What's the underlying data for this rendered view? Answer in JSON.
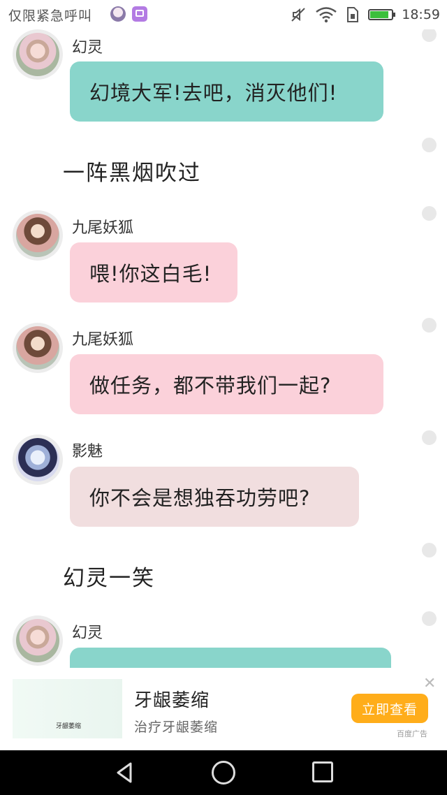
{
  "status_bar": {
    "left_text": "仅限紧急呼叫",
    "time": "18:59"
  },
  "chat": {
    "messages": [
      {
        "type": "character",
        "name": "幻灵",
        "text": "幻境大军!去吧，消灭他们!",
        "bubble_color": "#89d5cb"
      },
      {
        "type": "narration",
        "text": "一阵黑烟吹过"
      },
      {
        "type": "character",
        "name": "九尾妖狐",
        "text": "喂!你这白毛!",
        "bubble_color": "#fbd1da"
      },
      {
        "type": "character",
        "name": "九尾妖狐",
        "text": "做任务，都不带我们一起?",
        "bubble_color": "#fbd1da"
      },
      {
        "type": "character",
        "name": "影魅",
        "text": "你不会是想独吞功劳吧?",
        "bubble_color": "#f1dedf"
      },
      {
        "type": "narration",
        "text": "幻灵一笑"
      },
      {
        "type": "character",
        "name": "幻灵",
        "text": "",
        "bubble_color": "#89d5cb"
      }
    ]
  },
  "ad": {
    "thumb_text": "牙龈萎缩",
    "title": "牙龈萎缩",
    "subtitle": "治疗牙龈萎缩",
    "button": "立即查看",
    "close_glyph": "✕",
    "label": "百度广告",
    "button_color": "#ffad1a"
  },
  "icons": [
    "mute-icon",
    "wifi-icon",
    "sim-icon",
    "battery-icon",
    "close-icon",
    "back-icon",
    "home-icon",
    "recents-icon"
  ]
}
